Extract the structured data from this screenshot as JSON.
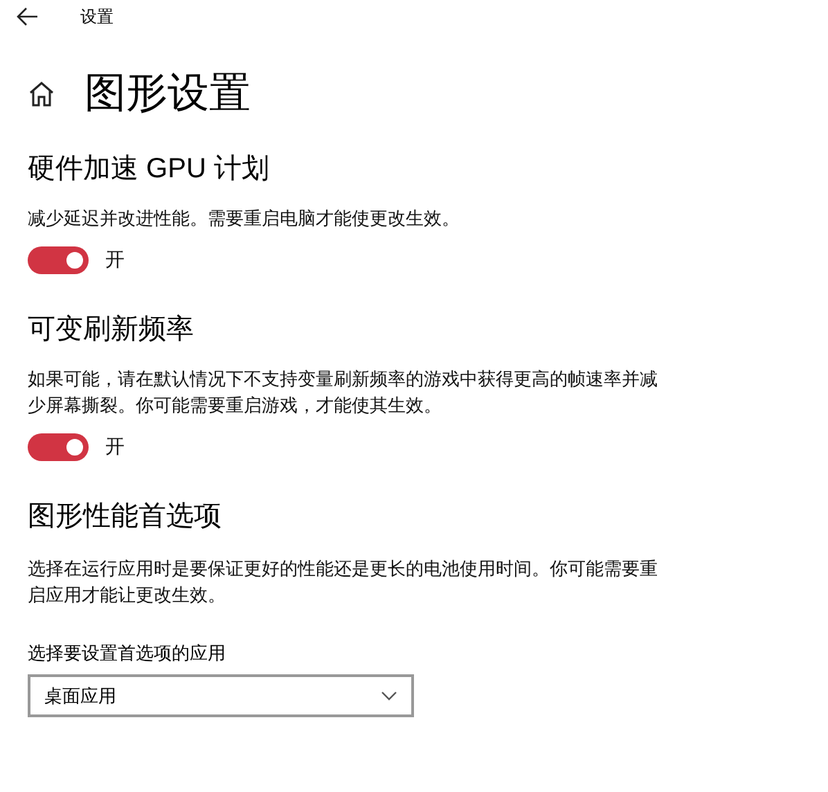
{
  "window": {
    "title": "设置"
  },
  "page": {
    "title": "图形设置"
  },
  "sections": [
    {
      "kind": "toggle",
      "title": "硬件加速 GPU 计划",
      "description": "减少延迟并改进性能。需要重启电脑才能使更改生效。",
      "toggle": {
        "on": true,
        "label": "开"
      }
    },
    {
      "kind": "toggle",
      "title": "可变刷新频率",
      "description": "如果可能，请在默认情况下不支持变量刷新频率的游戏中获得更高的帧速率并减少屏幕撕裂。你可能需要重启游戏，才能使其生效。",
      "toggle": {
        "on": true,
        "label": "开"
      }
    },
    {
      "kind": "dropdown",
      "title": "图形性能首选项",
      "description": "选择在运行应用时是要保证更好的性能还是更长的电池使用时间。你可能需要重启应用才能让更改生效。",
      "field_label": "选择要设置首选项的应用",
      "dropdown": {
        "value": "桌面应用"
      }
    }
  ]
}
